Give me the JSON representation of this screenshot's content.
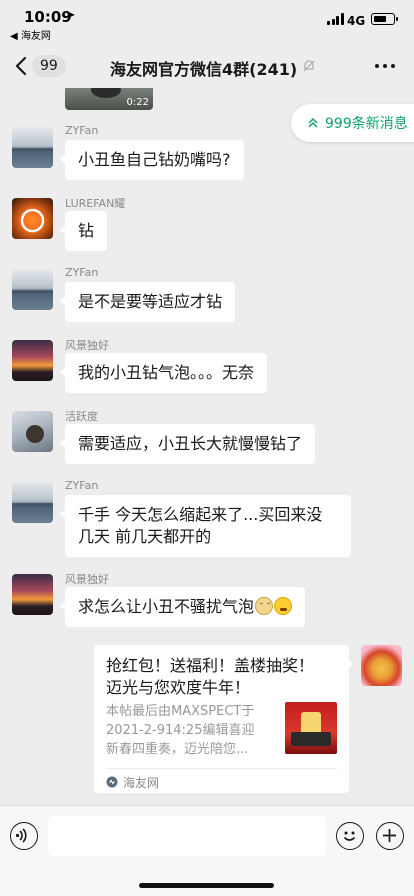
{
  "status_bar": {
    "time": "10:09",
    "back_to_app": "◀ 海友网",
    "network": "4G",
    "battery_level": 0.7
  },
  "nav": {
    "unread_count": "99",
    "title": "海友网官方微信4群(241)"
  },
  "video": {
    "duration": "0:22"
  },
  "new_messages": {
    "label": "999条新消息",
    "accent": "#12A36B"
  },
  "messages": [
    {
      "sender": "ZYFan",
      "text": "小丑鱼自己钻奶嘴吗?"
    },
    {
      "sender": "LUREFAN耀",
      "text": "钻"
    },
    {
      "sender": "ZYFan",
      "text": "是不是要等适应才钻"
    },
    {
      "sender": "风景独好",
      "text": "我的小丑钻气泡。。。无奈"
    },
    {
      "sender": "活跃度",
      "text": "需要适应，小丑长大就慢慢钻了"
    },
    {
      "sender": "ZYFan",
      "text_line1": "千手 今天怎么缩起来了...买回来没",
      "text_line2": "几天 前几天都开的"
    },
    {
      "sender": "风景独好",
      "text": "求怎么让小丑不骚扰气泡"
    }
  ],
  "link_card": {
    "title_line1": "抢红包！送福利！盖楼抽奖！",
    "title_line2": "迈光与您欢度牛年！",
    "desc_line1": "本帖最后由MAXSPECT于",
    "desc_line2": "2021-2-914:25编辑喜迎",
    "desc_line3": "新春四重奏，迈光陪您...",
    "source": "海友网"
  },
  "input": {
    "placeholder": ""
  },
  "colors": {
    "background": "#EDEDED",
    "bubble": "#FFFFFF",
    "accent": "#12A36B"
  }
}
